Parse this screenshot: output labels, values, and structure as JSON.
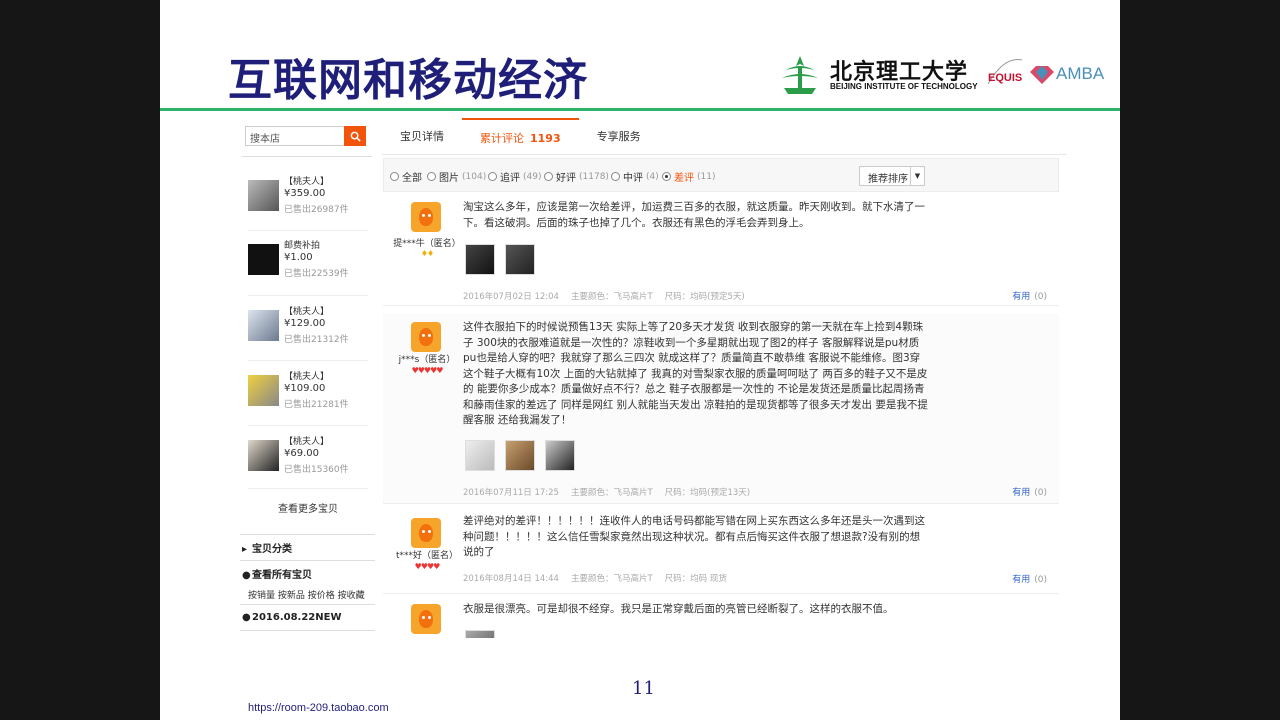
{
  "slide": {
    "title": "互联网和移动经济",
    "logo_cn": "北京理工大学",
    "logo_en": "BEIJING INSTITUTE OF TECHNOLOGY",
    "equis": "EQUIS",
    "amba": "AMBA",
    "page_number": "11",
    "footer_url": "https://room-209.taobao.com"
  },
  "shop": {
    "search_placeholder": "搜本店",
    "tabs": [
      {
        "label": "宝贝详情"
      },
      {
        "label": "累计评论",
        "count": "1193"
      },
      {
        "label": "专享服务"
      }
    ],
    "sidebar": {
      "items": [
        {
          "name": "【桃夫人】",
          "price": "¥359.00",
          "sold": "已售出26987件"
        },
        {
          "name": "邮费补拍",
          "price": "¥1.00",
          "sold": "已售出22539件"
        },
        {
          "name": "【桃夫人】",
          "price": "¥129.00",
          "sold": "已售出21312件"
        },
        {
          "name": "【桃夫人】",
          "price": "¥109.00",
          "sold": "已售出21281件"
        },
        {
          "name": "【桃夫人】",
          "price": "¥69.00",
          "sold": "已售出15360件"
        }
      ],
      "more": "查看更多宝贝",
      "category": "宝贝分类",
      "all": "查看所有宝贝",
      "sorts": "按销量 按新品 按价格 按收藏",
      "date_cat": "2016.08.22NEW"
    },
    "filters": [
      {
        "label": "全部",
        "count": ""
      },
      {
        "label": "图片",
        "count": "(104)"
      },
      {
        "label": "追评",
        "count": "(49)"
      },
      {
        "label": "好评",
        "count": "(1178)"
      },
      {
        "label": "中评",
        "count": "(4)"
      },
      {
        "label": "差评",
        "count": "(11)"
      }
    ],
    "sort_label": "推荐排序",
    "reviews": [
      {
        "user": "提***牛（匿名）",
        "badge": "♦♦",
        "text": "淘宝这么多年，应该是第一次给差评，加运费三百多的衣服，就这质量。昨天刚收到。就下水清了一下。看这破洞。后面的珠子也掉了几个。衣服还有黑色的浮毛会弄到身上。",
        "date": "2016年07月02日 12:04",
        "color": "主要颜色：飞马高片T",
        "size": "尺码：均码(预定5天)",
        "useful": "有用",
        "useful_count": "(0)"
      },
      {
        "user": "j***s（匿名）",
        "badge": "♥♥♥♥♥",
        "text": "这件衣服拍下的时候说预售13天 实际上等了20多天才发货 收到衣服穿的第一天就在车上捡到4颗珠子 300块的衣服难道就是一次性的？凉鞋收到一个多星期就出现了图2的样子 客服解释说是pu材质 pu也是给人穿的吧？我就穿了那么三四次 就成这样了？质量简直不敢恭维 客服说不能维修。图3穿这个鞋子大概有10次 上面的大钻就掉了 我真的对雪梨家衣服的质量呵呵哒了 两百多的鞋子又不是皮的 能要你多少成本？质量做好点不行？总之 鞋子衣服都是一次性的 不论是发货还是质量比起周扬青和藤雨佳家的差远了 同样是网红 别人就能当天发出 凉鞋拍的是现货都等了很多天才发出 要是我不提醒客服 还给我漏发了！",
        "date": "2016年07月11日 17:25",
        "color": "主要颜色：飞马高片T",
        "size": "尺码：均码(预定13天)",
        "useful": "有用",
        "useful_count": "(0)"
      },
      {
        "user": "t***好（匿名）",
        "badge": "♥♥♥♥",
        "text": "差评绝对的差评！！！！！！连收件人的电话号码都能写错在网上买东西这么多年还是头一次遇到这种问题！！！！！这么信任雪梨家竟然出现这种状况。都有点后悔买这件衣服了想退款?没有别的想说的了",
        "date": "2016年08月14日 14:44",
        "color": "主要颜色：飞马高片T",
        "size": "尺码：均码 现货",
        "useful": "有用",
        "useful_count": "(0)"
      },
      {
        "user": "",
        "badge": "",
        "text": "衣服是很漂亮。可是却很不经穿。我只是正常穿戴后面的亮管已经断裂了。这样的衣服不值。",
        "date": "",
        "color": "",
        "size": "",
        "useful": "",
        "useful_count": ""
      }
    ]
  },
  "colors": {
    "title": "#1f1f7a",
    "accent": "#f2540c",
    "rule": "#2bb36b",
    "link": "#3366cc"
  }
}
